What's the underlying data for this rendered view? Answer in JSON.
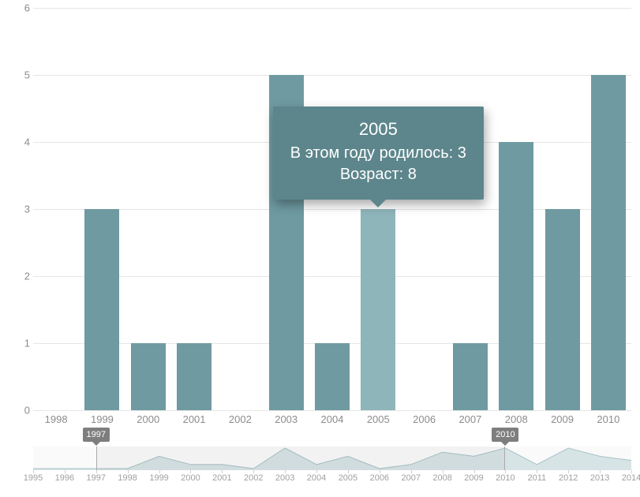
{
  "chart_data": {
    "type": "bar",
    "categories": [
      "1998",
      "1999",
      "2000",
      "2001",
      "2002",
      "2003",
      "2004",
      "2005",
      "2006",
      "2007",
      "2008",
      "2009",
      "2010"
    ],
    "values": [
      0,
      3,
      1,
      1,
      0,
      5,
      1,
      3,
      0,
      1,
      4,
      3,
      5
    ],
    "ylim": [
      0,
      6
    ],
    "yticks": [
      0,
      1,
      2,
      3,
      4,
      5,
      6
    ],
    "highlight_index": 7
  },
  "tooltip": {
    "title": "2005",
    "line1": "В этом году родилось: 3",
    "line2": "Возраст: 8"
  },
  "scrubber": {
    "categories": [
      "1995",
      "1996",
      "1997",
      "1998",
      "1999",
      "2000",
      "2001",
      "2002",
      "2003",
      "2004",
      "2005",
      "2006",
      "2007",
      "2008",
      "2009",
      "2010",
      "2011",
      "2012",
      "2013",
      "2014"
    ],
    "values": [
      0,
      0,
      0,
      0,
      0.3,
      0.1,
      0.1,
      0,
      0.5,
      0.1,
      0.3,
      0,
      0.1,
      0.4,
      0.3,
      0.5,
      0.1,
      0.5,
      0.3,
      0.2
    ],
    "selection_start_label": "1997",
    "selection_end_label": "2010",
    "selection_start_index": 2,
    "selection_end_index": 15
  },
  "colors": {
    "bar": "#6f9aa1",
    "bar_highlight": "#8eb5ba",
    "tooltip_bg": "#5d868c",
    "axis_text": "#8c8c8c",
    "handle_bg": "#7e7e7e",
    "mini_fill": "#d7e4e6",
    "mini_stroke": "#a8c2c6"
  }
}
